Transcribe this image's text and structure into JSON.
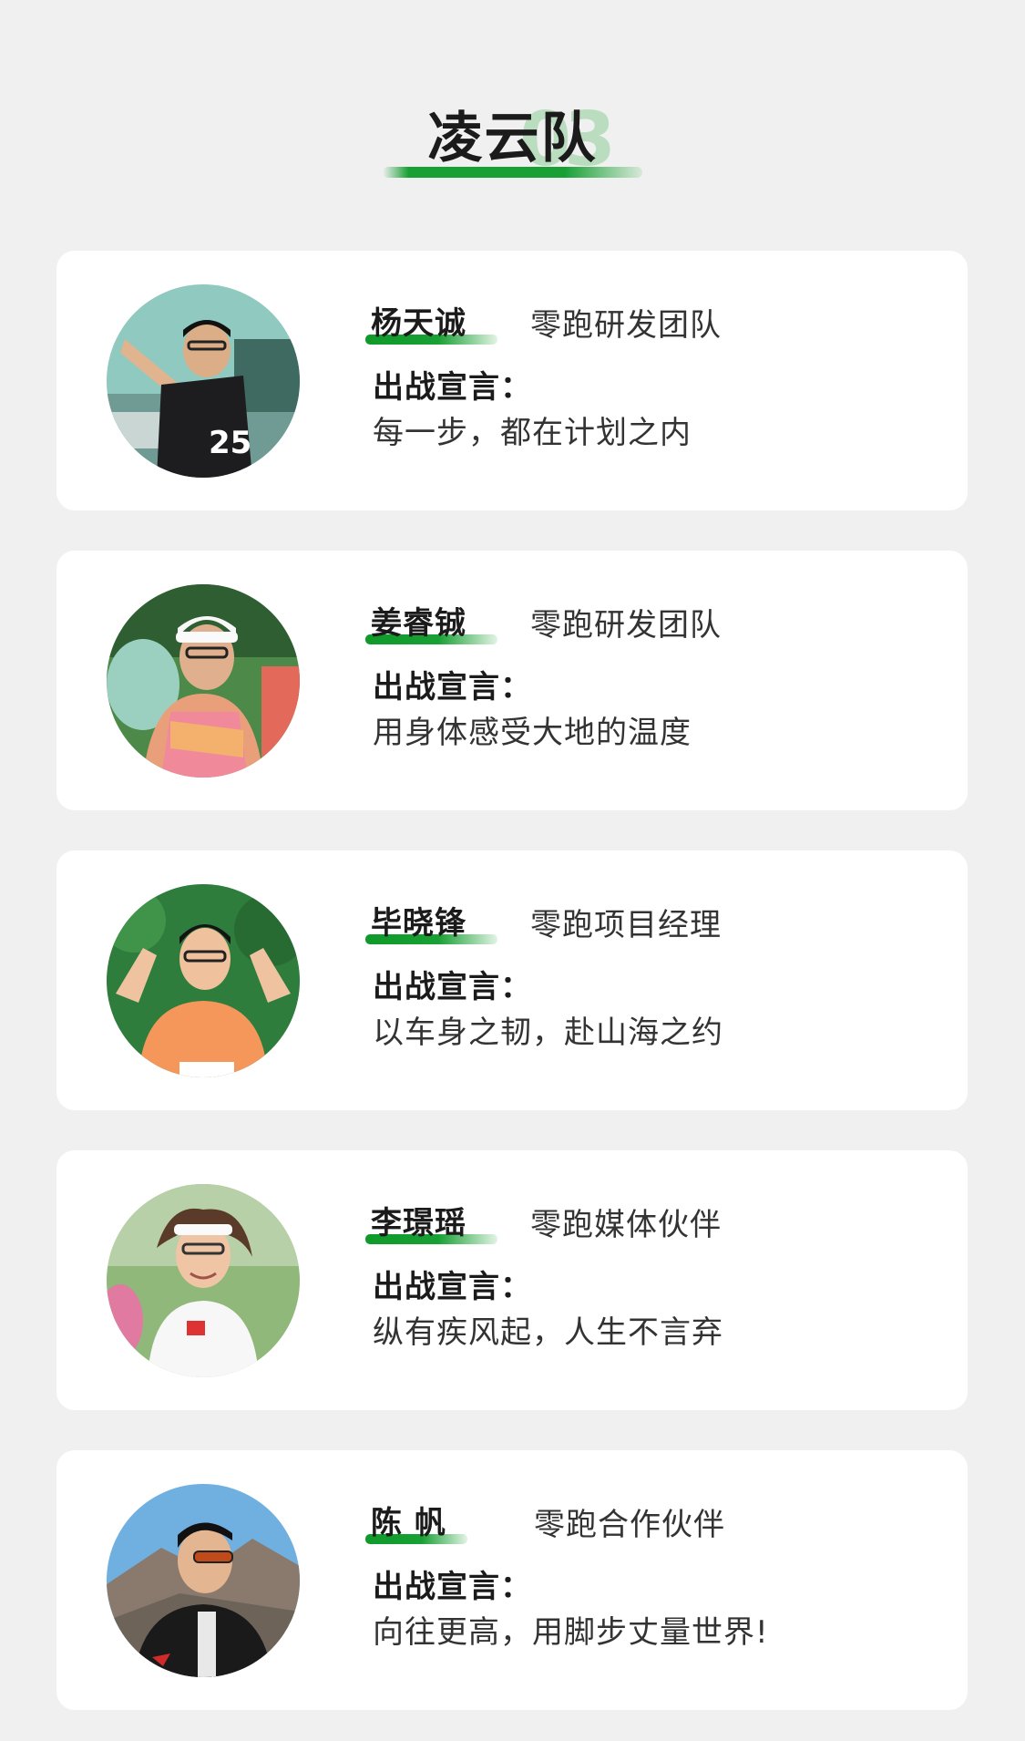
{
  "header": {
    "title": "凌云队",
    "badge": "03"
  },
  "members": [
    {
      "name": "杨天诚",
      "role": "零跑研发团队",
      "slogan_label": "出战宣言：",
      "slogan": "每一步，都在计划之内"
    },
    {
      "name": "姜睿铖",
      "role": "零跑研发团队",
      "slogan_label": "出战宣言：",
      "slogan": "用身体感受大地的温度"
    },
    {
      "name": "毕晓锋",
      "role": "零跑项目经理",
      "slogan_label": "出战宣言：",
      "slogan": "以车身之韧，赴山海之约"
    },
    {
      "name": "李璟瑶",
      "role": "零跑媒体伙伴",
      "slogan_label": "出战宣言：",
      "slogan": "纵有疾风起，人生不言弃"
    },
    {
      "name": "陈 帆",
      "role": "零跑合作伙伴",
      "slogan_label": "出战宣言：",
      "slogan": "向往更高，用脚步丈量世界!"
    }
  ],
  "colors": {
    "accent_green": "#18a034",
    "card_bg": "#ffffff",
    "page_bg": "#f0f0f0"
  }
}
